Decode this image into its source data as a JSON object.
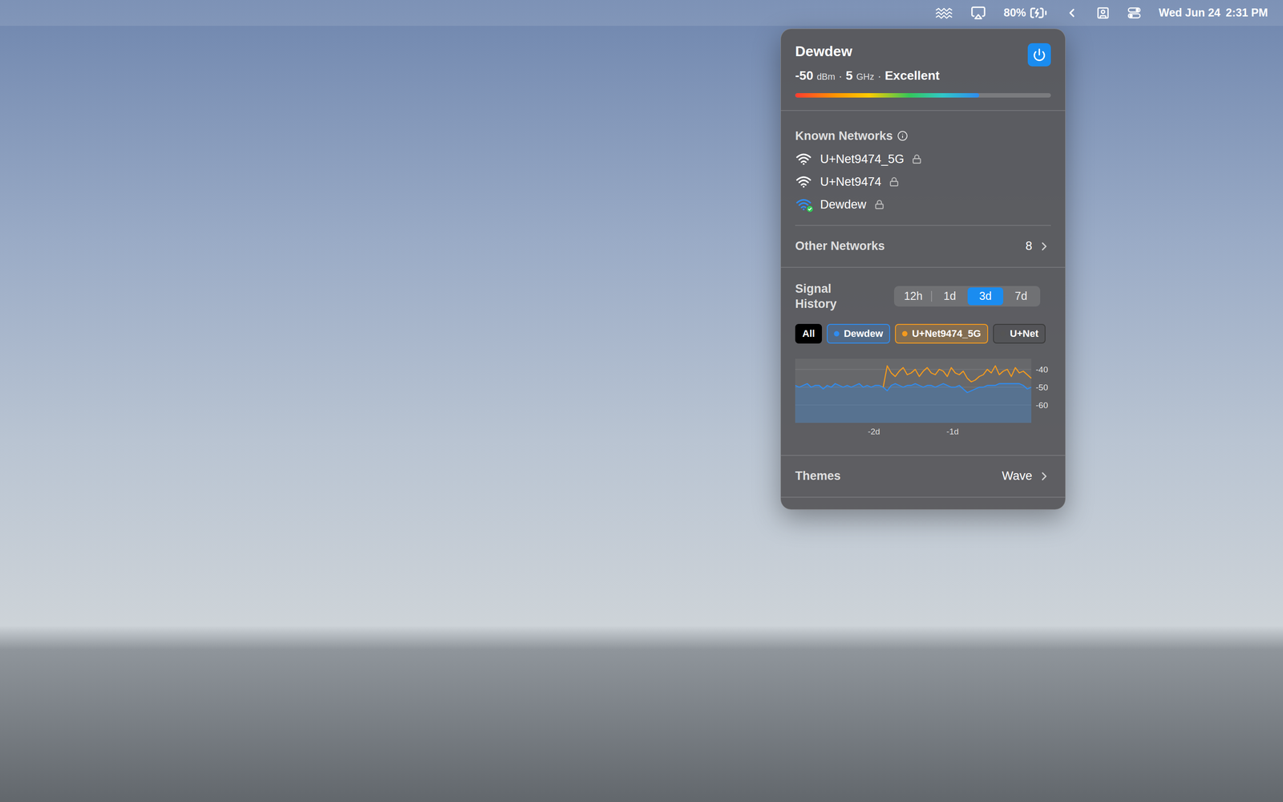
{
  "menu_bar": {
    "battery_percent": "80%",
    "battery_charging": true,
    "date": "Wed Jun 24",
    "time": "2:31 PM"
  },
  "wifi_panel": {
    "network": "Dewdew",
    "wifi_on": true,
    "signal": {
      "rssi": "-50",
      "rssi_unit": "dBm",
      "separator": "·",
      "band": "5",
      "band_unit": "GHz",
      "quality": "Excellent",
      "level": 0.72
    },
    "known_networks": {
      "title": "Known Networks",
      "items": [
        {
          "name": "U+Net9474_5G",
          "locked": true,
          "connected": false
        },
        {
          "name": "U+Net9474",
          "locked": true,
          "connected": false
        },
        {
          "name": "Dewdew",
          "locked": true,
          "connected": true
        }
      ]
    },
    "other_networks": {
      "label": "Other Networks",
      "count": "8"
    },
    "signal_history": {
      "title": "Signal History",
      "ranges": [
        {
          "label": "12h",
          "selected": false
        },
        {
          "label": "1d",
          "selected": false
        },
        {
          "label": "3d",
          "selected": true
        },
        {
          "label": "7d",
          "selected": false
        }
      ],
      "filters": [
        {
          "label": "All",
          "selected": true,
          "kind": "all"
        },
        {
          "label": "Dewdew",
          "selected": false,
          "kind": "network",
          "color": "#2f8cf0"
        },
        {
          "label": "U+Net9474_5G",
          "selected": false,
          "kind": "network",
          "color": "#f39a1e"
        },
        {
          "label": "U+Net",
          "selected": false,
          "kind": "network",
          "color": "#3a3a3a"
        }
      ],
      "chart": {
        "y_min": -70,
        "y_max": -34,
        "x_min": -3,
        "x_max": 0,
        "y_ticks": [
          {
            "label": "-40",
            "value": -40
          },
          {
            "label": "-50",
            "value": -50
          },
          {
            "label": "-60",
            "value": -60
          }
        ],
        "x_ticks": [
          {
            "label": "-2d",
            "value": -2
          },
          {
            "label": "-1d",
            "value": -1
          }
        ],
        "series": [
          {
            "name": "Dewdew",
            "color": "#2f8cf0",
            "values": [
              -49,
              -50,
              -49,
              -48,
              -50,
              -49,
              -49,
              -51,
              -49,
              -50,
              -48,
              -49,
              -50,
              -49,
              -50,
              -49,
              -48,
              -50,
              -49,
              -50,
              -49,
              -49,
              -50,
              -52,
              -49,
              -48,
              -49,
              -50,
              -49,
              -49,
              -48,
              -49,
              -50,
              -49,
              -49,
              -50,
              -49,
              -48,
              -49,
              -50,
              -50,
              -49,
              -51,
              -53,
              -52,
              -51,
              -50,
              -50,
              -49,
              -49,
              -49,
              -48,
              -48,
              -48,
              -48,
              -48,
              -48,
              -49,
              -51,
              -50
            ]
          },
          {
            "name": "U+Net9474_5G",
            "color": "#f39a1e",
            "values": [
              null,
              null,
              null,
              null,
              null,
              null,
              null,
              null,
              null,
              null,
              null,
              null,
              null,
              null,
              null,
              null,
              null,
              null,
              null,
              null,
              null,
              null,
              -50,
              -38,
              -42,
              -44,
              -41,
              -39,
              -43,
              -42,
              -40,
              -44,
              -41,
              -39,
              -42,
              -43,
              -40,
              -41,
              -44,
              -39,
              -42,
              -43,
              -41,
              -45,
              -47,
              -46,
              -44,
              -43,
              -40,
              -42,
              -38,
              -43,
              -41,
              -40,
              -44,
              -39,
              -42,
              -41,
              -43,
              -45
            ]
          },
          {
            "name": "U+Net9474",
            "color": "#3a3a3a",
            "values": []
          }
        ]
      }
    },
    "themes": {
      "label": "Themes",
      "value": "Wave"
    }
  }
}
